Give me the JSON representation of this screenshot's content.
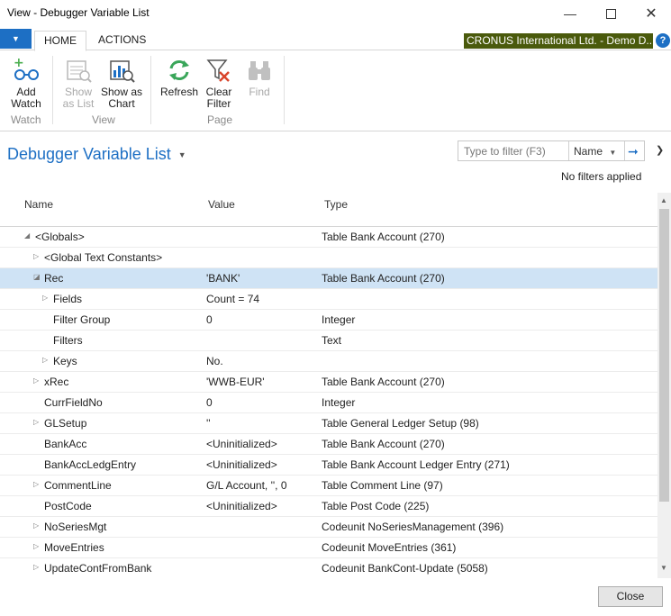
{
  "window": {
    "title": "View - Debugger Variable List",
    "minimize_icon": "minimize-icon",
    "maximize_icon": "maximize-icon",
    "close_icon": "close-icon"
  },
  "tabs": {
    "home": "HOME",
    "actions": "ACTIONS"
  },
  "company": "CRONUS International Ltd. - Demo D...",
  "help": "?",
  "ribbon": {
    "add_watch": {
      "line1": "Add",
      "line2": "Watch",
      "icon": "glasses-plus-icon"
    },
    "show_as_list": {
      "line1": "Show",
      "line2": "as List",
      "icon": "list-icon"
    },
    "show_as_chart": {
      "line1": "Show as",
      "line2": "Chart",
      "icon": "chart-icon"
    },
    "refresh": {
      "label": "Refresh",
      "icon": "refresh-icon"
    },
    "clear_filter": {
      "line1": "Clear",
      "line2": "Filter",
      "icon": "clear-filter-icon"
    },
    "find": {
      "label": "Find",
      "icon": "binoculars-icon"
    },
    "groups": {
      "watch": "Watch",
      "view": "View",
      "page": "Page"
    }
  },
  "page_title": "Debugger Variable List",
  "filter": {
    "placeholder": "Type to filter (F3)",
    "field": "Name",
    "status": "No filters applied"
  },
  "columns": {
    "name": "Name",
    "value": "Value",
    "type": "Type"
  },
  "rows": [
    {
      "name": "<Globals>",
      "value": "",
      "type": "Table Bank Account (270)",
      "indent": 0,
      "expander": "expanded"
    },
    {
      "name": "<Global Text Constants>",
      "value": "",
      "type": "",
      "indent": 1,
      "expander": "collapsed"
    },
    {
      "name": "Rec",
      "value": "'BANK'",
      "type": "Table Bank Account (270)",
      "indent": 1,
      "expander": "expanded-selected"
    },
    {
      "name": "Fields",
      "value": "Count = 74",
      "type": "",
      "indent": 2,
      "expander": "collapsed"
    },
    {
      "name": "Filter Group",
      "value": "0",
      "type": "Integer",
      "indent": 2,
      "expander": "none"
    },
    {
      "name": "Filters",
      "value": "",
      "type": "Text",
      "indent": 2,
      "expander": "none"
    },
    {
      "name": "Keys",
      "value": "No.",
      "type": "",
      "indent": 2,
      "expander": "collapsed"
    },
    {
      "name": "xRec",
      "value": "'WWB-EUR'",
      "type": "Table Bank Account (270)",
      "indent": 1,
      "expander": "collapsed"
    },
    {
      "name": "CurrFieldNo",
      "value": "0",
      "type": "Integer",
      "indent": 1,
      "expander": "none"
    },
    {
      "name": "GLSetup",
      "value": "''",
      "type": "Table General Ledger Setup (98)",
      "indent": 1,
      "expander": "collapsed"
    },
    {
      "name": "BankAcc",
      "value": "<Uninitialized>",
      "type": "Table Bank Account (270)",
      "indent": 1,
      "expander": "none"
    },
    {
      "name": "BankAccLedgEntry",
      "value": "<Uninitialized>",
      "type": "Table Bank Account Ledger Entry (271)",
      "indent": 1,
      "expander": "none"
    },
    {
      "name": "CommentLine",
      "value": "G/L Account, '', 0",
      "type": "Table Comment Line (97)",
      "indent": 1,
      "expander": "collapsed"
    },
    {
      "name": "PostCode",
      "value": "<Uninitialized>",
      "type": "Table Post Code (225)",
      "indent": 1,
      "expander": "none"
    },
    {
      "name": "NoSeriesMgt",
      "value": "",
      "type": "Codeunit NoSeriesManagement (396)",
      "indent": 1,
      "expander": "collapsed"
    },
    {
      "name": "MoveEntries",
      "value": "",
      "type": "Codeunit MoveEntries (361)",
      "indent": 1,
      "expander": "collapsed"
    },
    {
      "name": "UpdateContFromBank",
      "value": "",
      "type": "Codeunit BankCont-Update (5058)",
      "indent": 1,
      "expander": "collapsed"
    }
  ],
  "close_button": "Close",
  "colors": {
    "accent": "#1d6fc4",
    "company_bg": "#4a5a0c",
    "selected_row": "#cfe3f5"
  }
}
